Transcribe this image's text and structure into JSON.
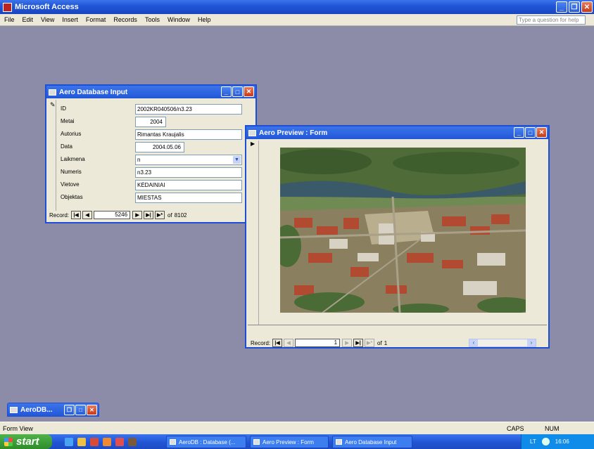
{
  "app": {
    "title": "Microsoft Access"
  },
  "menubar": {
    "items": [
      "File",
      "Edit",
      "View",
      "Insert",
      "Format",
      "Records",
      "Tools",
      "Window",
      "Help"
    ],
    "help_placeholder": "Type a question for help"
  },
  "input_form": {
    "title": "Aero Database Input",
    "fields": [
      {
        "label": "ID",
        "value": "2002KR040506/n3.23"
      },
      {
        "label": "Metai",
        "value": "2004"
      },
      {
        "label": "Autorius",
        "value": "Rimantas Kraujalis"
      },
      {
        "label": "Data",
        "value": "2004.05.06"
      },
      {
        "label": "Laikmena",
        "value": "n"
      },
      {
        "label": "Numeris",
        "value": "n3.23"
      },
      {
        "label": "Vietove",
        "value": "KĖDAINIAI"
      },
      {
        "label": "Objektas",
        "value": "MIESTAS"
      }
    ],
    "nav": {
      "label": "Record:",
      "current": "5246",
      "of_label": "of",
      "total": "8102"
    }
  },
  "preview_form": {
    "title": "Aero Preview : Form",
    "nav": {
      "label": "Record:",
      "current": "1",
      "of_label": "of",
      "total": "1"
    }
  },
  "minimized": {
    "title": "AeroDB..."
  },
  "statusbar": {
    "left": "Form View",
    "caps": "CAPS",
    "num": "NUM"
  },
  "taskbar": {
    "start": "start",
    "tasks": [
      "AeroDB : Database (...",
      "Aero Preview : Form",
      "Aero Database Input"
    ],
    "lang": "LT",
    "clock": "16:06"
  }
}
